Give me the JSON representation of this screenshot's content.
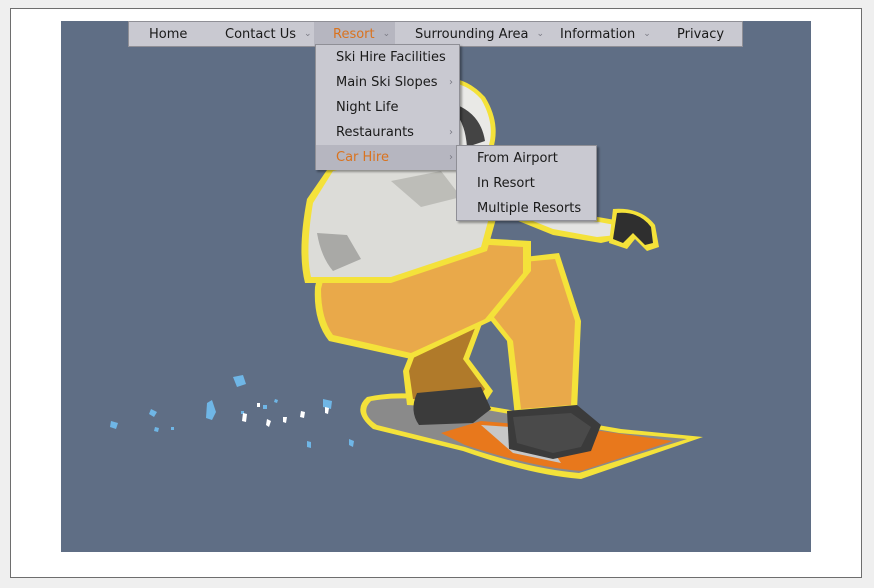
{
  "menu": {
    "items": [
      {
        "label": "Home",
        "has_submenu": false,
        "active": false
      },
      {
        "label": "Contact Us",
        "has_submenu": true,
        "active": false
      },
      {
        "label": "Resort",
        "has_submenu": true,
        "active": true
      },
      {
        "label": "Surrounding Area",
        "has_submenu": true,
        "active": false
      },
      {
        "label": "Information",
        "has_submenu": true,
        "active": false
      },
      {
        "label": "Privacy",
        "has_submenu": false,
        "active": false
      }
    ],
    "caret_icon": "chevron-down-icon"
  },
  "resort_submenu": {
    "items": [
      {
        "label": "Ski Hire Facilities",
        "has_submenu": false,
        "active": false
      },
      {
        "label": "Main Ski Slopes",
        "has_submenu": true,
        "active": false
      },
      {
        "label": "Night Life",
        "has_submenu": false,
        "active": false
      },
      {
        "label": "Restaurants",
        "has_submenu": true,
        "active": false
      },
      {
        "label": "Car Hire",
        "has_submenu": true,
        "active": true
      }
    ],
    "arrow_icon": "chevron-right-icon"
  },
  "car_hire_submenu": {
    "items": [
      {
        "label": "From Airport"
      },
      {
        "label": "In Resort"
      },
      {
        "label": "Multiple Resorts"
      }
    ]
  },
  "colors": {
    "menu_bg": "#c9c9d1",
    "menu_active_bg": "#b6b6c0",
    "menu_active_text": "#d9731f",
    "stage_bg": "#5f6e85"
  }
}
